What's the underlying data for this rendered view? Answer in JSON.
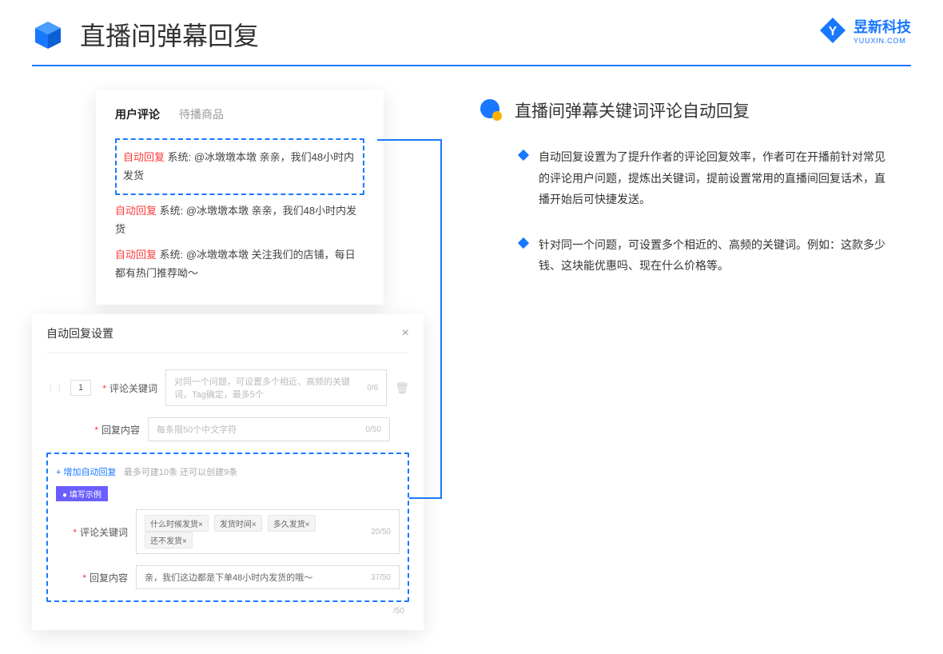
{
  "header": {
    "title": "直播间弹幕回复"
  },
  "logo": {
    "name": "昱新科技",
    "sub": "YUUXIN.COM"
  },
  "panelTop": {
    "tabs": {
      "active": "用户评论",
      "inactive": "待播商品"
    },
    "comment1": {
      "tag": "自动回复",
      "text": "系统: @冰墩墩本墩 亲亲，我们48小时内发货"
    },
    "comment2": {
      "tag": "自动回复",
      "text": "系统: @冰墩墩本墩 亲亲，我们48小时内发货"
    },
    "comment3": {
      "tag": "自动回复",
      "text": "系统: @冰墩墩本墩 关注我们的店铺，每日都有热门推荐呦～"
    }
  },
  "panelBottom": {
    "title": "自动回复设置",
    "rowNum": "1",
    "label1": "评论关键词",
    "placeholder1": "对同一个问题，可设置多个相近、高频的关键词，Tag确定，最多5个",
    "count1": "0/6",
    "label2": "回复内容",
    "placeholder2": "每条限50个中文字符",
    "count2": "0/50",
    "addLink": "+ 增加自动回复",
    "addHint": "最多可建10条 还可以创建9条",
    "exampleTag": "● 填写示例",
    "exLabel1": "评论关键词",
    "kw1": "什么时候发货×",
    "kw2": "发货时间×",
    "kw3": "多久发货×",
    "kw4": "还不发货×",
    "exCount1": "20/50",
    "exLabel2": "回复内容",
    "exText2": "亲，我们这边都是下单48小时内发货的哦～",
    "exCount2": "37/50",
    "count3": "/50"
  },
  "right": {
    "sectionTitle": "直播间弹幕关键词评论自动回复",
    "bullet1": "自动回复设置为了提升作者的评论回复效率，作者可在开播前针对常见的评论用户问题，提炼出关键词，提前设置常用的直播间回复话术，直播开始后可快捷发送。",
    "bullet2": "针对同一个问题，可设置多个相近的、高频的关键词。例如：这款多少钱、这块能优惠吗、现在什么价格等。"
  }
}
